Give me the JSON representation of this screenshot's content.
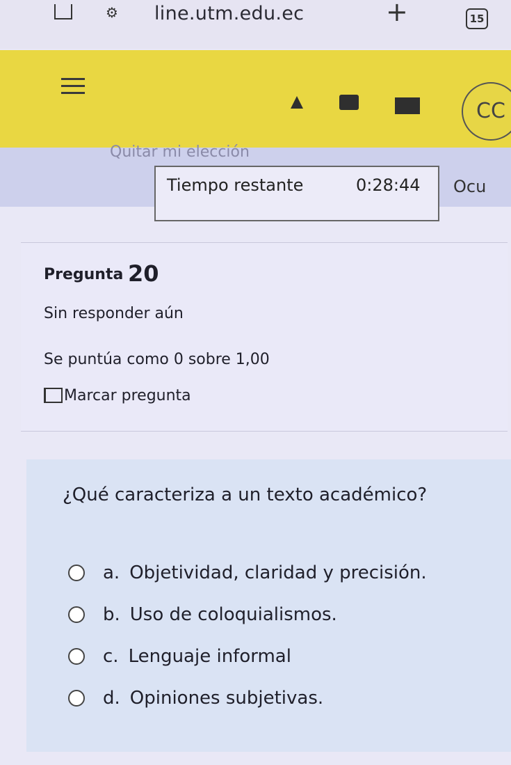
{
  "browser": {
    "url": "line.utm.edu.ec",
    "tab_count": "15"
  },
  "header": {
    "avatar_initials": "CC"
  },
  "timer": {
    "hidden_label": "Quitar mi elección",
    "label": "Tiempo restante",
    "value": "0:28:44",
    "hide_button": "Ocu"
  },
  "question_info": {
    "question_word": "Pregunta",
    "question_number": "20",
    "status": "Sin responder aún",
    "grade": "Se puntúa como 0 sobre 1,00",
    "flag_label": "Marcar pregunta"
  },
  "question": {
    "text": "¿Qué caracteriza a un texto académico?",
    "options": [
      {
        "letter": "a.",
        "text": "Objetividad, claridad y precisión."
      },
      {
        "letter": "b.",
        "text": "Uso de coloquialismos."
      },
      {
        "letter": "c.",
        "text": "Lenguaje informal"
      },
      {
        "letter": "d.",
        "text": "Opiniones subjetivas."
      }
    ]
  },
  "colors": {
    "header_yellow": "#e9d742",
    "band_blue": "#cdd0ec",
    "question_bg": "#dae3f4"
  }
}
